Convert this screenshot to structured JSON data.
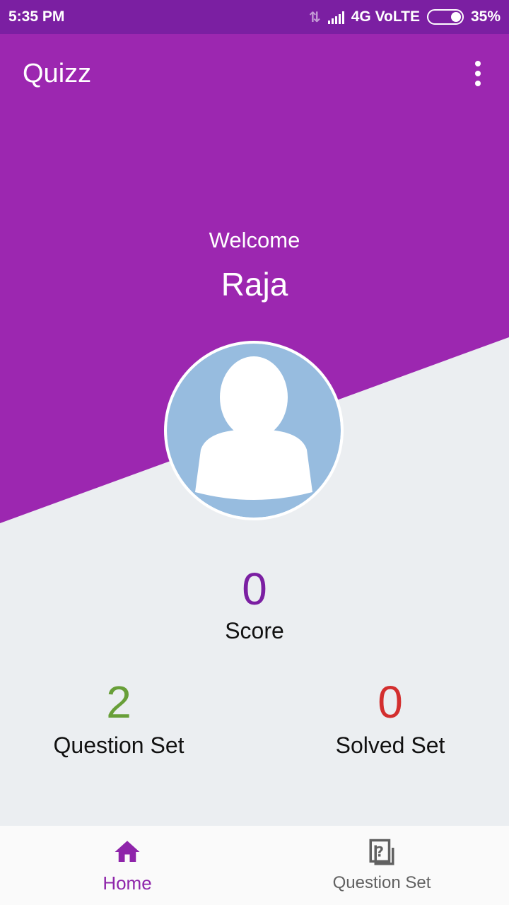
{
  "status_bar": {
    "time": "5:35 PM",
    "network": "4G VoLTE",
    "battery": "35%"
  },
  "toolbar": {
    "title": "Quizz",
    "menu_icon": "more-vert-icon"
  },
  "hero": {
    "welcome": "Welcome",
    "username": "Raja"
  },
  "stats": {
    "score_value": "0",
    "score_label": "Score",
    "question_set_value": "2",
    "question_set_label": "Question Set",
    "solved_set_value": "0",
    "solved_set_label": "Solved Set"
  },
  "bottom_nav": {
    "items": [
      {
        "label": "Home",
        "icon": "home-icon",
        "active": true
      },
      {
        "label": "Question Set",
        "icon": "question-set-icon",
        "active": false
      }
    ]
  },
  "colors": {
    "primary": "#9C27B0",
    "primary_dark": "#7B1FA2",
    "background": "#EBEEF1",
    "question_set_value": "#689F38",
    "solved_set_value": "#D32F2F"
  }
}
